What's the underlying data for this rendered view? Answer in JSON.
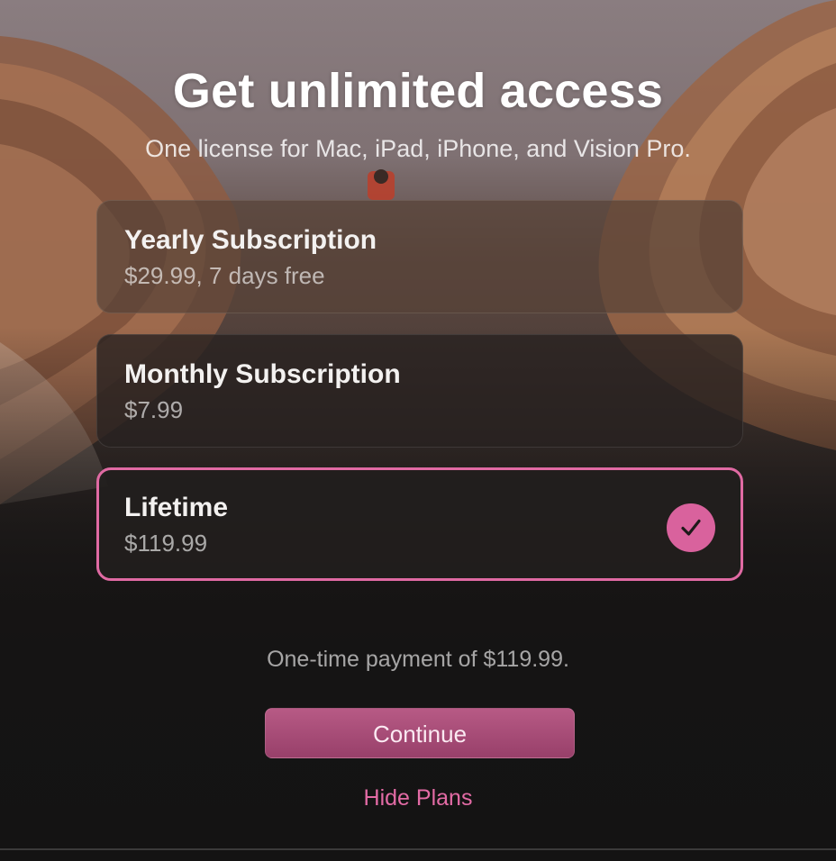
{
  "header": {
    "title": "Get unlimited access",
    "subtitle": "One license for Mac, iPad, iPhone, and Vision Pro."
  },
  "plans": [
    {
      "name": "Yearly Subscription",
      "price": "$29.99, 7 days free",
      "selected": false
    },
    {
      "name": "Monthly Subscription",
      "price": "$7.99",
      "selected": false
    },
    {
      "name": "Lifetime",
      "price": "$119.99",
      "selected": true
    }
  ],
  "selected_icon": "checkmark-icon",
  "footer": {
    "note": "One-time payment of $119.99.",
    "continue_label": "Continue",
    "hide_plans_label": "Hide Plans"
  },
  "colors": {
    "accent": "#e06aa3",
    "button": "#a84c77",
    "background": "#151414"
  }
}
